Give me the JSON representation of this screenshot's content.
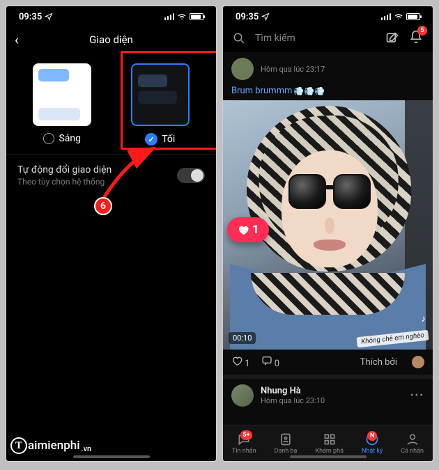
{
  "status": {
    "time": "09:35",
    "wifi_label": "wifi-icon",
    "battery_pct": 80
  },
  "left": {
    "title": "Giao diện",
    "light_label": "Sáng",
    "dark_label": "Tối",
    "auto_title": "Tự động đổi giao diện",
    "auto_sub": "Theo tùy chọn hệ thống",
    "step_num": "6"
  },
  "right": {
    "search_placeholder": "Tìm kiếm",
    "notif_count": "5",
    "post1": {
      "timestamp": "Hôm qua lúc 23:17",
      "text": "Brum brummm",
      "like_count": "1",
      "video_time": "00:10",
      "video_caption": "Không chê em nghèo",
      "actions_like": "1",
      "actions_comment": "0",
      "liked_by_label": "Thích bởi"
    },
    "post2": {
      "name": "Nhung Hà",
      "timestamp": "Hôm qua lúc 23:10"
    },
    "tabs": {
      "messages": "Tin nhắn",
      "messages_badge": "5+",
      "contacts": "Danh bạ",
      "discover": "Khám phá",
      "diary": "Nhật ký",
      "diary_badge": "N",
      "me": "Cá nhân"
    }
  },
  "watermark": {
    "text": "aimienphi",
    "suffix": ".vn"
  }
}
